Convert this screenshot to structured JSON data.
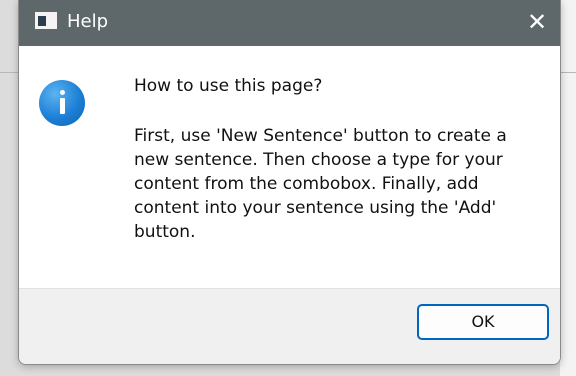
{
  "window": {
    "title": "Help",
    "close_glyph": "✕",
    "title_icon": "app-window-icon",
    "titlebar_color": "#5e6769"
  },
  "message": {
    "icon": "info-icon",
    "heading": "How to use this page?",
    "lines": [
      "First, use 'New Sentence' button to create a",
      "new sentence. Then choose a type for your",
      "content from the combobox. Finally, add",
      "content into your sentence using the 'Add'",
      "button."
    ]
  },
  "buttons": {
    "ok_label": "OK",
    "accent": "#0067c0"
  }
}
